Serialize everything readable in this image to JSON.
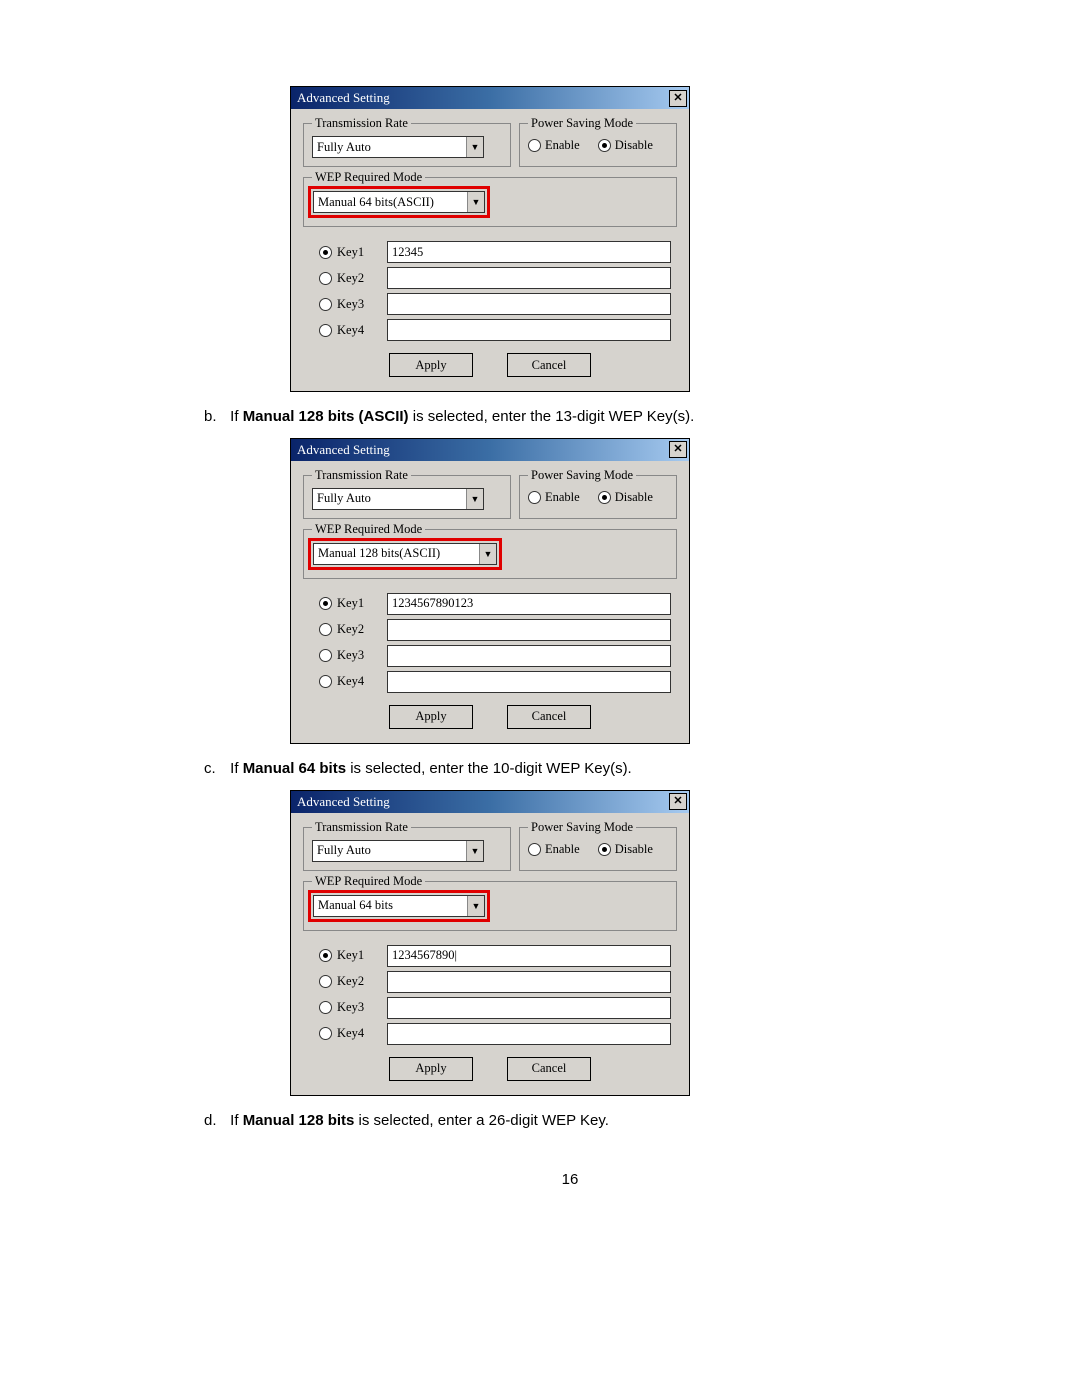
{
  "page_number": "16",
  "instructions": {
    "b": {
      "letter": "b.",
      "pre": "If ",
      "bold": "Manual 128 bits (ASCII)",
      "post": " is selected, enter the 13-digit WEP Key(s)."
    },
    "c": {
      "letter": "c.",
      "pre": "If ",
      "bold": "Manual 64 bits",
      "post": " is selected, enter the 10-digit WEP Key(s)."
    },
    "d": {
      "letter": "d.",
      "pre": "If ",
      "bold": "Manual 128 bits",
      "post": " is selected, enter a 26-digit WEP Key."
    }
  },
  "common": {
    "title": "Advanced Setting",
    "transmission_label": "Transmission Rate",
    "transmission_value": "Fully Auto",
    "power_label": "Power Saving Mode",
    "power_enable": "Enable",
    "power_disable": "Disable",
    "wep_label": "WEP Required Mode",
    "key1": "Key1",
    "key2": "Key2",
    "key3": "Key3",
    "key4": "Key4",
    "apply": "Apply",
    "cancel": "Cancel"
  },
  "dlg1": {
    "wep_value": "Manual 64 bits(ASCII)",
    "key1_value": "12345"
  },
  "dlg2": {
    "wep_value": "Manual 128 bits(ASCII)",
    "key1_value": "1234567890123"
  },
  "dlg3": {
    "wep_value": "Manual 64 bits",
    "key1_value": "1234567890|"
  }
}
